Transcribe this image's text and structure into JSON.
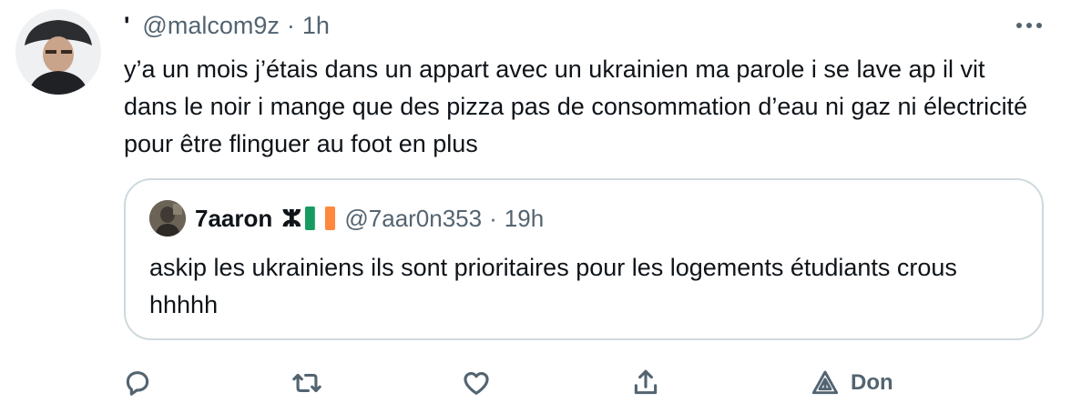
{
  "tweet": {
    "display_name": "'",
    "handle": "@malcom9z",
    "separator": "·",
    "time": "1h",
    "text": "y’a un mois j’étais dans un appart avec un ukrainien ma parole i se lave ap il vit dans le noir i mange que des pizza pas de consommation d’eau ni gaz ni électricité pour être flinguer au foot en plus"
  },
  "quoted_tweet": {
    "display_name": "7aaron",
    "badge_glyph": "ⵣ",
    "handle": "@7aar0n353",
    "separator": "·",
    "time": "19h",
    "text": "askip les ukrainiens ils sont prioritaires pour les logements étudiants crous hhhhh"
  },
  "actions": {
    "reply_icon": "reply-icon",
    "retweet_icon": "retweet-icon",
    "like_icon": "like-icon",
    "share_icon": "share-icon",
    "donate_icon": "donate-icon",
    "donate_label": "Don"
  },
  "colors": {
    "text_primary": "#0f1419",
    "text_secondary": "#536471",
    "border": "#cfd9de",
    "flag_green": "#169b62",
    "flag_white": "#ffffff",
    "flag_orange": "#ff883e"
  }
}
